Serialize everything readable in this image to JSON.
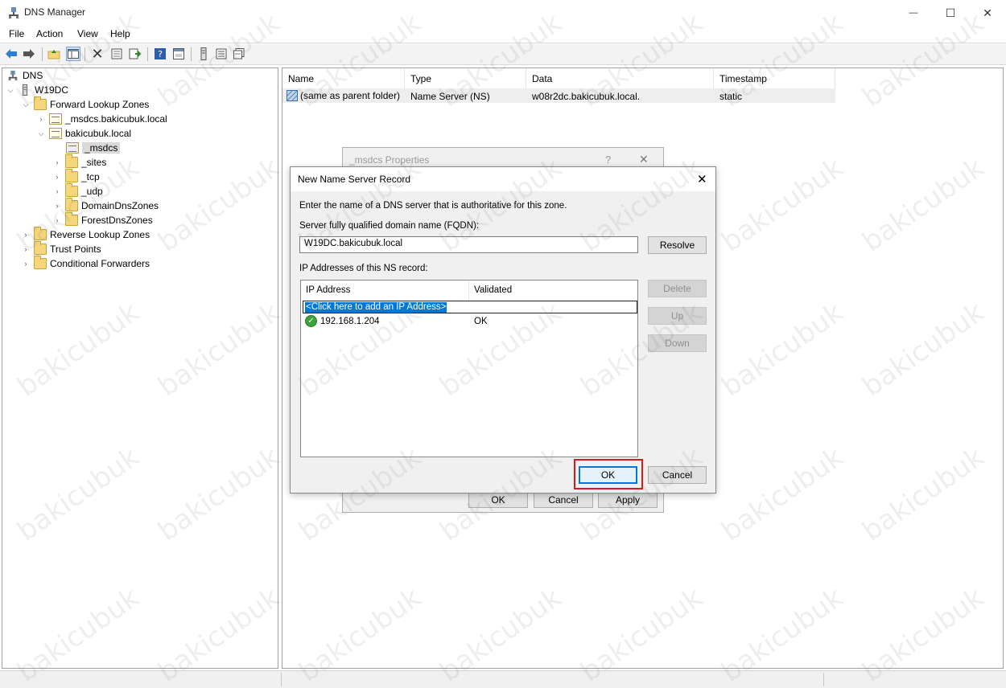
{
  "window": {
    "title": "DNS Manager",
    "minimize": "—",
    "maximize": "☐",
    "close": "✕"
  },
  "menu": [
    "File",
    "Action",
    "View",
    "Help"
  ],
  "toolbar": {
    "icons": [
      "back-arrow-icon",
      "forward-arrow-icon",
      "up-folder-icon",
      "show-hide-tree-icon",
      "delete-icon",
      "properties-icon",
      "export-list-icon",
      "help-icon",
      "console-icon",
      "server-icon",
      "list-icon",
      "records-icon"
    ]
  },
  "tree": {
    "root": "DNS",
    "server": "W19DC",
    "forward": "Forward Lookup Zones",
    "msdcs_zone": "_msdcs.bakicubuk.local",
    "domain_zone": "bakicubuk.local",
    "msdcs": "_msdcs",
    "sites": "_sites",
    "tcp": "_tcp",
    "udp": "_udp",
    "domaindns": "DomainDnsZones",
    "forestdns": "ForestDnsZones",
    "reverse": "Reverse Lookup Zones",
    "trust": "Trust Points",
    "conditional": "Conditional Forwarders"
  },
  "list": {
    "columns": [
      "Name",
      "Type",
      "Data",
      "Timestamp"
    ],
    "rows": [
      {
        "name": "(same as parent folder)",
        "type": "Name Server (NS)",
        "data": "w08r2dc.bakicubuk.local.",
        "timestamp": "static"
      }
    ]
  },
  "props_dialog": {
    "title": "_msdcs Properties",
    "help": "?",
    "close": "✕",
    "ok": "OK",
    "cancel": "Cancel",
    "apply": "Apply"
  },
  "ns_dialog": {
    "title": "New Name Server Record",
    "close": "✕",
    "instruction": "Enter the name of a DNS server that is authoritative for this zone.",
    "fqdn_label": "Server fully qualified domain name (FQDN):",
    "fqdn_value": "W19DC.bakicubuk.local",
    "resolve": "Resolve",
    "ip_label": "IP Addresses of this NS record:",
    "ip_columns": [
      "IP Address",
      "Validated"
    ],
    "add_ip": "<Click here to add an IP Address>",
    "ips": [
      {
        "address": "192.168.1.204",
        "validated": "OK"
      }
    ],
    "delete": "Delete",
    "up": "Up",
    "down": "Down",
    "ok": "OK",
    "cancel": "Cancel"
  },
  "watermark": "bakicubuk"
}
